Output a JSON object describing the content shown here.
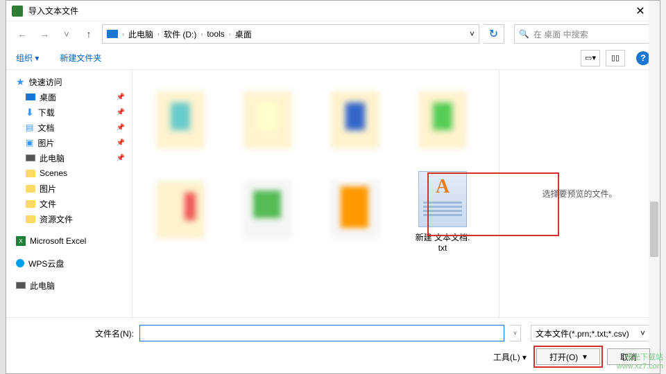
{
  "dialog": {
    "title": "导入文本文件",
    "close": "✕"
  },
  "nav": {
    "back": "←",
    "forward": "→",
    "up": "↑",
    "refresh": "↻",
    "path_dd": "˅"
  },
  "breadcrumbs": [
    "此电脑",
    "软件 (D:)",
    "tools",
    "桌面"
  ],
  "search": {
    "placeholder": "在 桌面 中搜索",
    "icon": "🔍"
  },
  "toolbar": {
    "organize": "组织 ▾",
    "newfolder": "新建文件夹",
    "view_dd": "▾",
    "help": "?"
  },
  "sidebar": {
    "quick": "快速访问",
    "desktop": "桌面",
    "downloads": "下载",
    "documents": "文档",
    "pictures": "图片",
    "thispc": "此电脑",
    "scenes": "Scenes",
    "pictures2": "图片",
    "files": "文件",
    "resources": "资源文件",
    "excel": "Microsoft Excel",
    "wps": "WPS云盘",
    "thispc2": "此电脑"
  },
  "files": {
    "blurred": " ",
    "txt_name": "新建 文本文档.",
    "txt_ext": "txt"
  },
  "preview": {
    "text": "选择要预览的文件。"
  },
  "footer": {
    "filename_label": "文件名(N):",
    "filename_value": "",
    "filter": "文本文件(*.prn;*.txt;*.csv)",
    "filter_dd": "˅",
    "tools": "工具(L)",
    "tools_dd": "▾",
    "open": "打开(O)",
    "cancel": "取消"
  },
  "watermark": {
    "l1": "极光下载站",
    "l2": "www.xz7.com"
  }
}
